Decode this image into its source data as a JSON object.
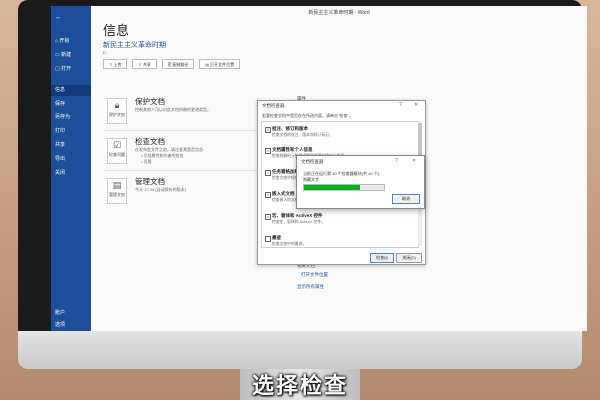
{
  "window_title": "新民主主义革命时期 - Word",
  "sidebar": {
    "back_icon": "arrow-left-icon",
    "items": [
      {
        "label": "开始",
        "icon": "home-icon"
      },
      {
        "label": "新建",
        "icon": "new-doc-icon"
      },
      {
        "label": "打开",
        "icon": "folder-icon"
      },
      {
        "label": "信息",
        "active": true
      },
      {
        "label": "保存"
      },
      {
        "label": "另存为"
      },
      {
        "label": "打印"
      },
      {
        "label": "共享"
      },
      {
        "label": "导出"
      },
      {
        "label": "关闭"
      }
    ],
    "bottom": [
      "账户",
      "选项"
    ]
  },
  "info": {
    "title": "信息",
    "doc_name": "新民主主义革命时期",
    "doc_path": "E:",
    "buttons": [
      "上传",
      "共享",
      "复制路径",
      "打开文件位置"
    ]
  },
  "sections": {
    "protect": {
      "icon_label": "保护文档",
      "title": "保护文档",
      "desc": "控制其他人可以对此文档所做的更改类型。"
    },
    "inspect": {
      "icon_label": "检查问题",
      "title": "检查文档",
      "desc": "在发布此文件之前，请注意其是否包含:",
      "bullets": [
        "文档属性和作者的姓名",
        "页眉"
      ]
    },
    "manage": {
      "icon_label": "管理文档",
      "title": "管理文档",
      "desc": "今天 17:34 (自动保存的版本)"
    }
  },
  "right_panel": {
    "props_label": "属性",
    "related_docs": "相关文档",
    "open_location": "打开文件位置",
    "show_all": "显示所有属性"
  },
  "inspector_dialog": {
    "title": "文档检查器",
    "intro": "若要检查文档中是否存在所选内容，请单击\"检查\"。",
    "options": [
      {
        "label": "批注、修订和版本",
        "desc": "检查文档的批注、版本和修订标记。",
        "checked": true
      },
      {
        "label": "文档属性和个人信息",
        "desc": "检查隐藏的元数据或随文档保存的个人信息。",
        "checked": true
      },
      {
        "label": "任务窗格加载项",
        "desc": "检查文档中保存的任务窗格加载项。",
        "checked": true
      },
      {
        "label": "嵌入式文档",
        "desc": "检查嵌入的文档，其中可能包含未显示的信息。",
        "checked": true
      },
      {
        "label": "宏、窗体和 ActiveX 控件",
        "desc": "检查宏、窗体和 ActiveX 控件。",
        "checked": true
      },
      {
        "label": "墨迹",
        "desc": "检查文档中的墨迹。",
        "checked": false
      }
    ],
    "inspect_button": "检查(I)",
    "close_button": "关闭(C)"
  },
  "progress_dialog": {
    "title": "文档检查器",
    "status": "当前正在运行第 10 个检查器模块(共 10 个):",
    "current": "隐藏文字",
    "progress": 0.7,
    "cancel_button": "取消"
  },
  "caption": "选择检查",
  "colors": {
    "sidebar": "#1e4e9a",
    "progress": "#06b025",
    "accent": "#2b579a"
  }
}
